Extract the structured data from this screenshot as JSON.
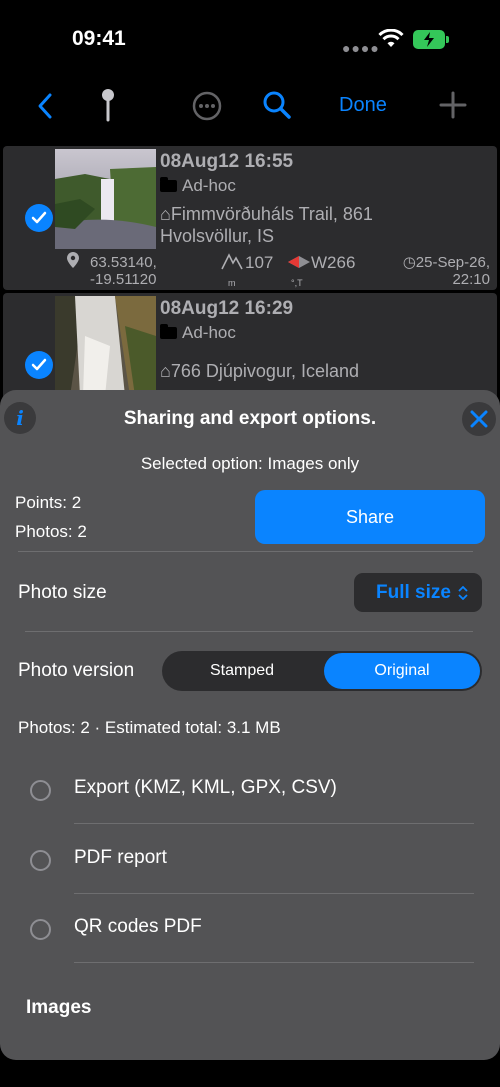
{
  "status": {
    "time": "09:41"
  },
  "nav": {
    "done_label": "Done"
  },
  "rows": [
    {
      "title": "08Aug12 16:55",
      "folder": "Ad-hoc",
      "address_line1": "⌂Fimmvörðuháls Trail, 861",
      "address_line2": "Hvolsvöllur, IS",
      "lat": "63.53140,",
      "lon": "-19.51120",
      "altitude": "107",
      "alt_unit": "m",
      "heading": "W266",
      "heading_unit": "°,T",
      "date": "◷25-Sep-26,",
      "time": "22:10",
      "selected": true
    },
    {
      "title": "08Aug12 16:29",
      "folder": "Ad-hoc",
      "address_line1": "⌂766 Djúpivogur, Iceland",
      "selected": true
    }
  ],
  "sheet": {
    "title": "Sharing and export options.",
    "selected_option": "Selected option: Images only",
    "points": "Points: 2",
    "photos": "Photos: 2",
    "share_label": "Share",
    "photo_size_label": "Photo size",
    "photo_size_value": "Full size",
    "photo_version_label": "Photo version",
    "version_options": [
      "Stamped",
      "Original"
    ],
    "version_selected": "Original",
    "estimate": "Photos: 2 · Estimated total: 3.1 MB",
    "options": [
      "Export (KMZ, KML, GPX, CSV)",
      "PDF report",
      "QR codes PDF"
    ],
    "images_label": "Images"
  },
  "colors": {
    "accent": "#0a84ff",
    "sheet_bg": "#535355",
    "battery": "#34c759"
  }
}
